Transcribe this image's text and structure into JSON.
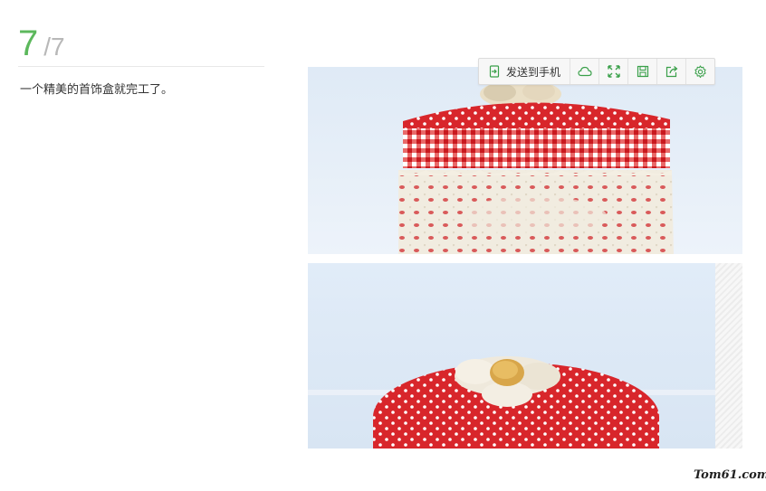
{
  "step": {
    "current": "7",
    "total": "/7"
  },
  "description": "一个精美的首饰盒就完工了。",
  "toolbar": {
    "send_to_phone_label": "发送到手机",
    "icons": [
      "send-to-phone-icon",
      "cloud-icon",
      "fullscreen-icon",
      "save-icon",
      "share-icon",
      "settings-icon"
    ]
  },
  "colors": {
    "accent_green": "#5cb85c",
    "polka_red": "#d8262b",
    "sky": "#e4eef8"
  },
  "watermark": "Tom61.com"
}
